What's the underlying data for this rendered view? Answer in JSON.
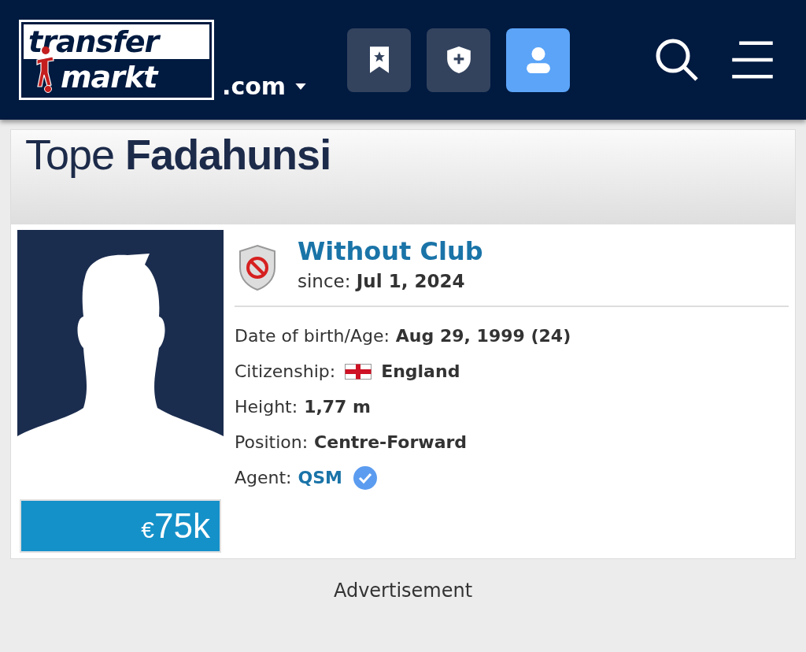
{
  "header": {
    "logo": {
      "top": "transfer",
      "bottom": "markt"
    },
    "domain": ".com",
    "nav_buttons": [
      {
        "kind": "watchlist",
        "selected": false
      },
      {
        "kind": "club",
        "selected": false
      },
      {
        "kind": "profile",
        "selected": true
      }
    ]
  },
  "player": {
    "name": "Tope **Fadahunsi**",
    "market_value": {
      "currency": "€",
      "amount": "75k"
    },
    "club": {
      "name": "Without Club",
      "since_label": "since:",
      "since": "Jul 1, 2024"
    },
    "details": [
      {
        "kind": "text",
        "label": "Date of birth/Age:",
        "value": "Aug 29, 1999 (24)"
      },
      {
        "kind": "flag",
        "label": "Citizenship:",
        "value": "England"
      },
      {
        "kind": "text",
        "label": "Height:",
        "value": "1,77 m"
      },
      {
        "kind": "text",
        "label": "Position:",
        "value": "Centre-Forward"
      },
      {
        "kind": "verified-link",
        "label": "Agent:",
        "value": "QSM"
      }
    ]
  },
  "advertisement": "Advertisement"
}
